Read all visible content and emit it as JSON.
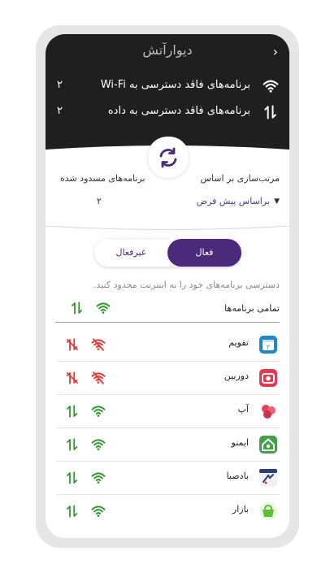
{
  "header": {
    "title": "دیوارآتش",
    "back_glyph": "›",
    "wifi_row": {
      "label": "برنامه‌های فاقد دسترسی به Wi-Fi",
      "count": "۲",
      "icon": "wifi-icon"
    },
    "data_row": {
      "label": "برنامه‌های فاقد دسترسی به داده",
      "count": "۲",
      "icon": "data-arrows-icon"
    }
  },
  "sync_icon": "sync-icon",
  "sort": {
    "label": "مرتب‌سازی بر اساس",
    "value": "براساس پیش فرض",
    "caret": "▼"
  },
  "blocked": {
    "label": "برنامه‌های مسدود شده",
    "count": "۲"
  },
  "segment": {
    "active": "فعال",
    "inactive": "غیرفعال"
  },
  "hint": "دسترسی برنامه‌های خود را به اینترنت محدود کنید.",
  "all_apps": {
    "label": "تمامی برنامه‌ها",
    "wifi": "allowed",
    "data": "allowed"
  },
  "apps": [
    {
      "name": "تقویم",
      "icon": "calendar-icon",
      "wifi": "blocked",
      "data": "blocked"
    },
    {
      "name": "دوربین",
      "icon": "camera-icon",
      "wifi": "blocked",
      "data": "blocked"
    },
    {
      "name": "آپ",
      "icon": "ap-icon",
      "wifi": "allowed",
      "data": "allowed"
    },
    {
      "name": "ایمنو",
      "icon": "immuno-icon",
      "wifi": "allowed",
      "data": "allowed"
    },
    {
      "name": "بادصبا",
      "icon": "badsaba-icon",
      "wifi": "allowed",
      "data": "allowed"
    },
    {
      "name": "بازار",
      "icon": "bazaar-icon",
      "wifi": "allowed",
      "data": "allowed"
    }
  ],
  "colors": {
    "header_bg": "#1f1f1f",
    "accent": "#4b2a7b",
    "allowed": "#2e9a2e",
    "blocked": "#e53935",
    "calendar": "#1e88c8",
    "camera": "#e53950",
    "ap": "#e0425a",
    "immuno": "#43a047",
    "bazaar": "#5fbf34"
  }
}
